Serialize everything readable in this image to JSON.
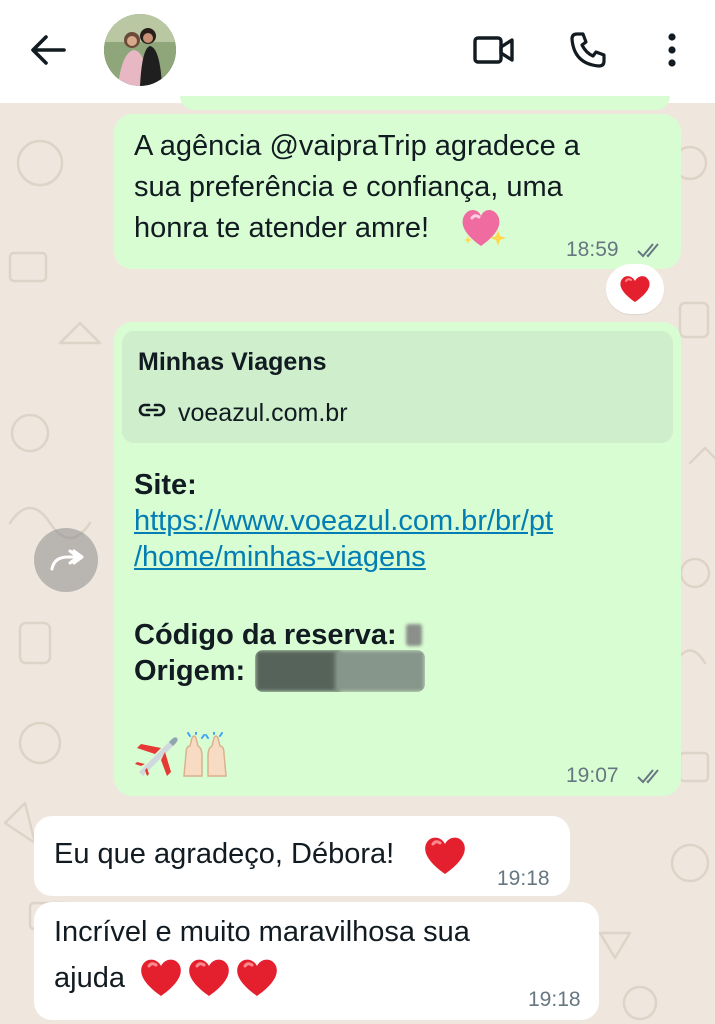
{
  "header": {
    "back_icon": "arrow-back-icon",
    "avatar_alt": "contact-avatar",
    "icons": [
      "video-call-icon",
      "phone-icon",
      "more-vert-icon"
    ]
  },
  "messages": [
    {
      "direction": "outgoing",
      "lines": [
        "A agência @vaipraTrip agradece a",
        "sua preferência e confiança, uma",
        "honra te atender amre!"
      ],
      "emoji": "sparkling-heart",
      "time": "18:59",
      "status": "read",
      "reaction": "red-heart"
    },
    {
      "direction": "outgoing",
      "preview": {
        "title": "Minhas Viagens",
        "domain": "voeazul.com.br"
      },
      "site_label": "Site:",
      "url_lines": [
        "https://www.voeazul.com.br/br/pt",
        "/home/minhas-viagens"
      ],
      "code_label": "Código da reserva:",
      "origin_label": "Origem:",
      "emojis": [
        "airplane",
        "raising-hands"
      ],
      "time": "19:07",
      "status": "read"
    },
    {
      "direction": "incoming",
      "text": "Eu que agradeço, Débora!",
      "emoji": "red-heart",
      "time": "19:18"
    },
    {
      "direction": "incoming",
      "lines": [
        "Incrível e muito maravilhosa sua",
        "ajuda"
      ],
      "emojis": [
        "red-heart",
        "red-heart",
        "red-heart"
      ],
      "time": "19:18"
    }
  ],
  "colors": {
    "outgoing_bubble": "#d9fdd3",
    "incoming_bubble": "#ffffff",
    "link": "#027eb5",
    "chat_background": "#efe7dd"
  }
}
